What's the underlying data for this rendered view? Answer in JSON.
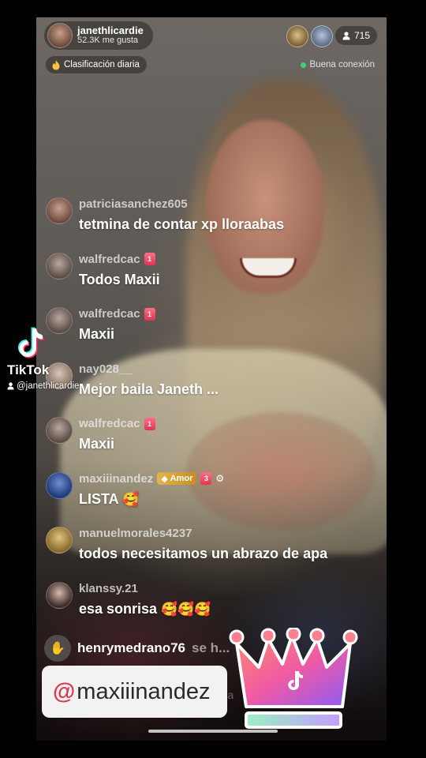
{
  "host": {
    "username": "janethlicardie",
    "likes": "52.3K me gusta"
  },
  "viewers": {
    "count": "715"
  },
  "daily_rank": {
    "label": "Clasificación diaria"
  },
  "connection": {
    "status": "Buena conexión",
    "status_color": "#3ad37a"
  },
  "chat": [
    {
      "user": "patriciasanchez605",
      "text": "tetmina de contar xp lloraabas",
      "avatar_color": "#8a6a5c"
    },
    {
      "user": "walfredcac",
      "level": "1",
      "text": "Todos Maxii",
      "avatar_color": "#7b6a60"
    },
    {
      "user": "walfredcac",
      "level": "1",
      "text": "Maxii",
      "avatar_color": "#7b6a60"
    },
    {
      "user": "nay028__",
      "text": "Mejor baila Janeth ...",
      "avatar_color": "#a59080"
    },
    {
      "user": "walfredcac",
      "level": "1",
      "text": "Maxii",
      "avatar_color": "#7b6a60"
    },
    {
      "user": "maxiiinandez",
      "badge": "Amor",
      "level": "3",
      "text": "LISTA",
      "emoji": "🥰",
      "avatar_color": "#3d5ea8"
    },
    {
      "user": "manuelmorales4237",
      "text": "todos necesitamos un abrazo de apa",
      "avatar_color": "#c29c5a"
    },
    {
      "user": "klanssy.21",
      "text": "esa sonrisa",
      "emoji": "🥰🥰🥰",
      "avatar_color": "#4a3a36"
    }
  ],
  "join": {
    "user": "henrymedrano76",
    "text": "se h...",
    "icon": "wave-hand-icon"
  },
  "faint_bottom_text": "rda",
  "watermark": {
    "brand": "TikTok",
    "handle": "@janethlicardie"
  },
  "handle_card": {
    "at": "@",
    "name": "maxiiinandez"
  },
  "colors": {
    "accent_red": "#e2364f",
    "level_badge": "#e0344f",
    "amor_badge": "#d9a43a"
  }
}
